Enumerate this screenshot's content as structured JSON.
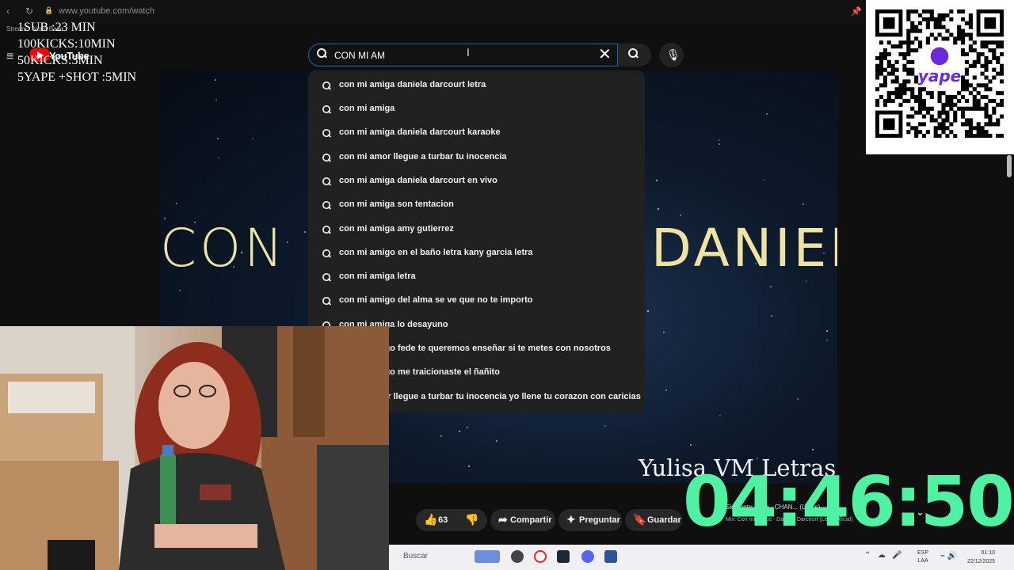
{
  "browser": {
    "url": "www.youtube.com/watch",
    "back_icon": "‹",
    "reload_icon": "↻"
  },
  "header": {
    "menu_icon": "≡",
    "logo_text": "YouTube",
    "search_value": "CON MI AM",
    "clear_icon": "✕",
    "voice_icon": "🎙"
  },
  "overlay": {
    "stream_label": "Stream - Nova Base",
    "lines": [
      "1SUB :23 MIN",
      "100KICKS:10MIN",
      "50KICKS:3MIN",
      "5YAPE +SHOT :5MIN"
    ]
  },
  "suggestions": [
    "con mi amiga daniela darcourt letra",
    "con mi amiga",
    "con mi amiga daniela darcourt karaoke",
    "con mi amor llegue a turbar tu inocencia",
    "con mi amiga daniela darcourt en vivo",
    "con mi amiga son tentacion",
    "con mi amiga amy gutierrez",
    "con mi amigo en el baño letra kany garcia letra",
    "con mi amiga letra",
    "con mi amigo del alma se ve que no te importo",
    "con mi amiga lo desayuno",
    "con mi amigo fede te queremos enseñar si te metes con nosotros",
    "con mi amigo me traicionaste el ñañito",
    "con mi amor llegue a turbar tu inocencia yo llene tu corazon con caricias"
  ],
  "video": {
    "title_left": "CON",
    "title_right": "DANIELA",
    "channel_watermark": "Yulisa VM Letras"
  },
  "qr": {
    "brand": "yape"
  },
  "actions": {
    "like_count": "63",
    "share_label": "Compartir",
    "ask_label": "Preguntar",
    "save_label": "Guardar"
  },
  "next_video": {
    "title": "Siguiente: ...yla - CHAN... (Lyrics)",
    "subtitle": "Mix: Con mi amiga - Daniela Darcourt (Letra Oficial)"
  },
  "timer": "04:46:50",
  "taskbar": {
    "search_label": "Buscar",
    "lang": [
      "ESP",
      "LAA"
    ],
    "time": "01:10",
    "date": "22/12/2025"
  },
  "colors": {
    "accent_timer": "#4ff2a3",
    "search_border": "#1c62b9",
    "yt_red": "#ff0000"
  }
}
